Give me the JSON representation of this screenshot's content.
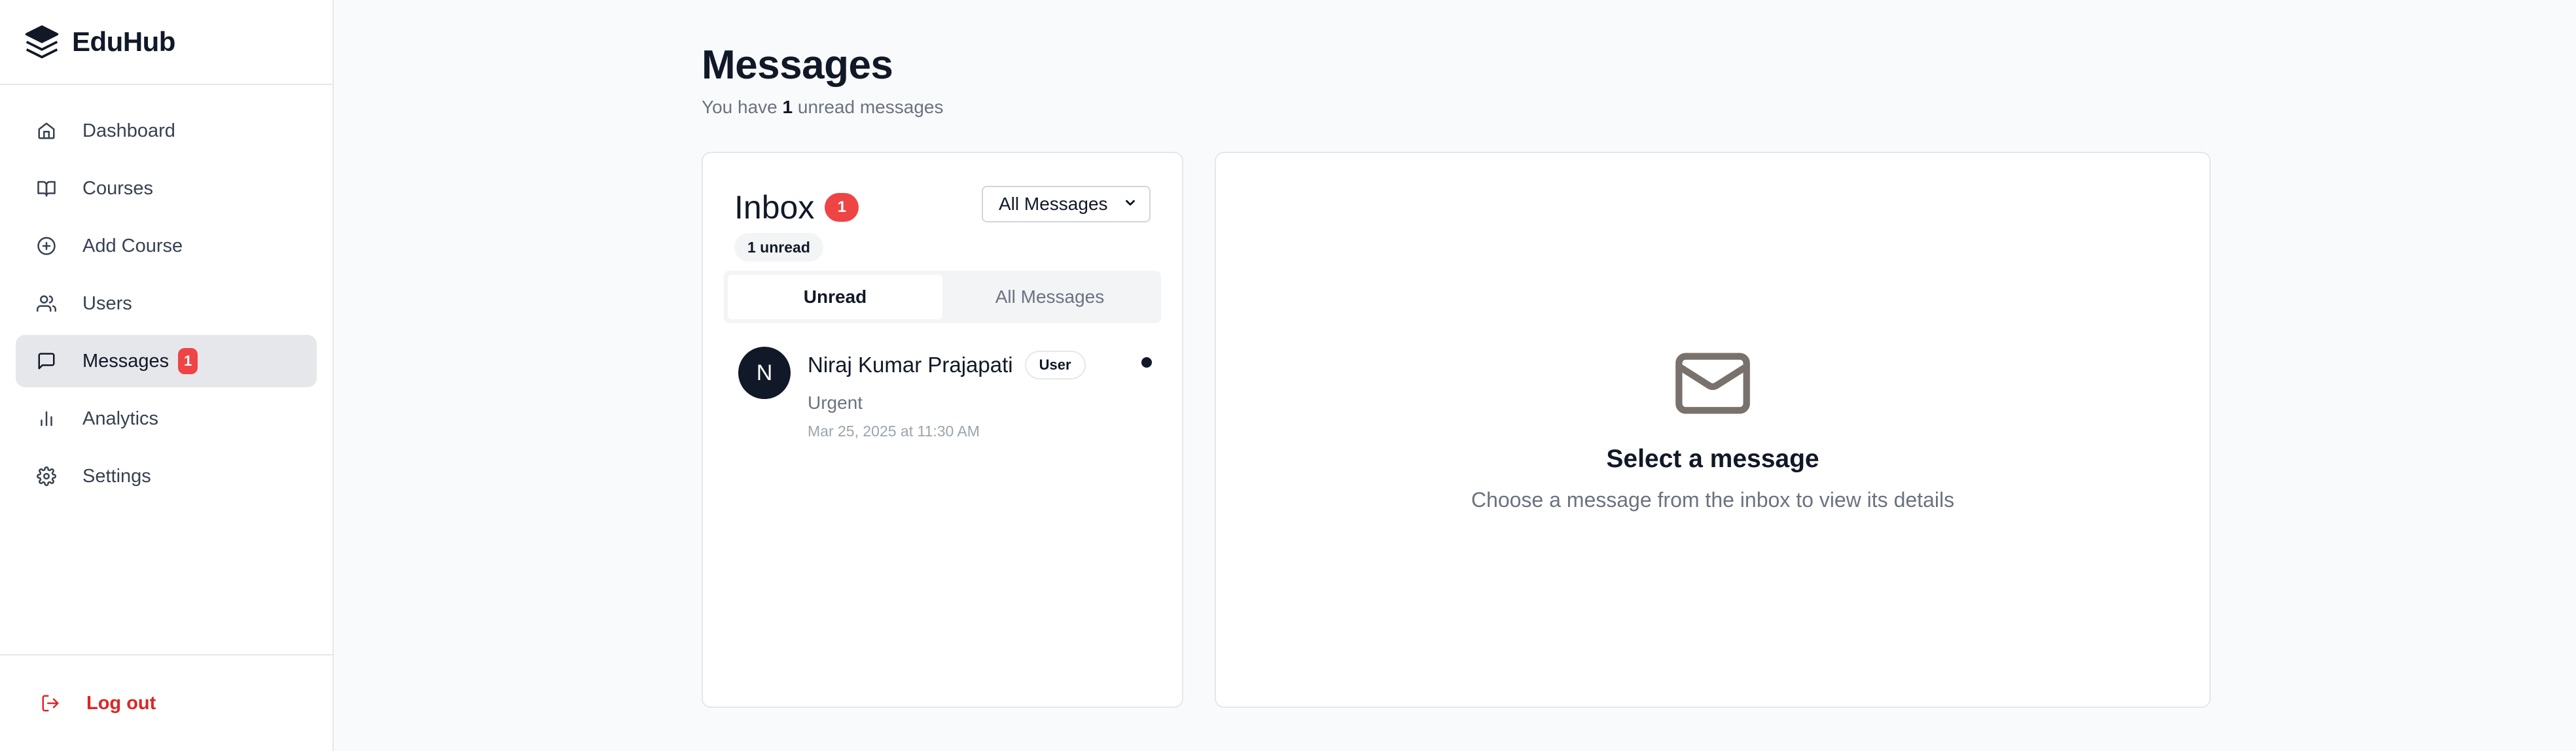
{
  "app": {
    "name": "EduHub",
    "logo_icon": "layers-icon"
  },
  "sidebar": {
    "items": [
      {
        "label": "Dashboard",
        "icon": "home-icon"
      },
      {
        "label": "Courses",
        "icon": "book-icon"
      },
      {
        "label": "Add Course",
        "icon": "plus-circle-icon"
      },
      {
        "label": "Users",
        "icon": "users-icon"
      },
      {
        "label": "Messages",
        "icon": "message-square-icon",
        "badge": "1",
        "active": true
      },
      {
        "label": "Analytics",
        "icon": "bar-chart-icon"
      },
      {
        "label": "Settings",
        "icon": "gear-icon"
      }
    ],
    "logout_label": "Log out",
    "logout_icon": "log-out-icon"
  },
  "page": {
    "title": "Messages",
    "subtitle_prefix": "You have",
    "subtitle_count": "1",
    "subtitle_suffix": "unread messages"
  },
  "inbox": {
    "title": "Inbox",
    "count_badge": "1",
    "unread_pill": "1 unread",
    "filter_selected": "All Messages",
    "tabs": [
      {
        "label": "Unread",
        "active": true
      },
      {
        "label": "All Messages",
        "active": false
      }
    ],
    "messages": [
      {
        "avatar_initial": "N",
        "sender": "Niraj Kumar Prajapati",
        "role": "User",
        "subject": "Urgent",
        "timestamp": "Mar 25, 2025 at 11:30 AM",
        "unread": true
      }
    ]
  },
  "detail": {
    "empty_icon": "mail-icon",
    "empty_title": "Select a message",
    "empty_text": "Choose a message from the inbox to view its details"
  },
  "colors": {
    "accent": "#111827",
    "badge": "#ef4444",
    "logout": "#dc2626",
    "background": "#f9fafb"
  }
}
